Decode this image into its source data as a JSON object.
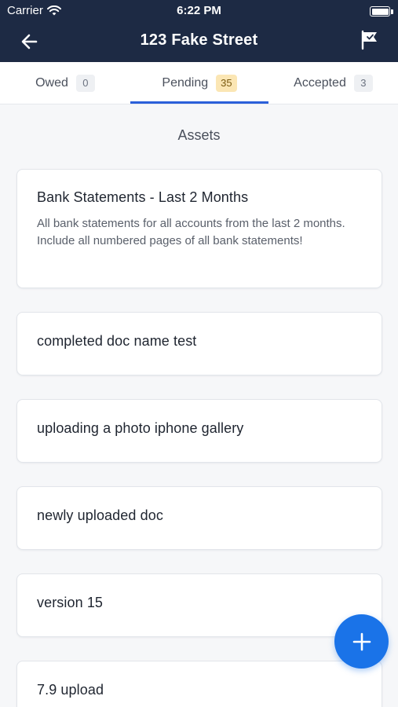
{
  "status_bar": {
    "carrier": "Carrier",
    "time": "6:22 PM",
    "wifi_icon": "wifi-icon",
    "battery_level": 1.0
  },
  "header": {
    "title": "123 Fake Street",
    "back_icon": "arrow-left-icon",
    "flag_icon": "flag-icon"
  },
  "tabs": [
    {
      "label": "Owed",
      "count": "0",
      "active": false
    },
    {
      "label": "Pending",
      "count": "35",
      "active": true
    },
    {
      "label": "Accepted",
      "count": "3",
      "active": false
    }
  ],
  "section": {
    "title": "Assets"
  },
  "documents": [
    {
      "title": "Bank Statements - Last 2 Months",
      "description": "All bank statements for all accounts from the last 2 months. Include all numbered pages of all bank statements!"
    },
    {
      "title": "completed doc name test"
    },
    {
      "title": "uploading a photo iphone gallery"
    },
    {
      "title": "newly uploaded doc"
    },
    {
      "title": "version 15"
    },
    {
      "title": "7.9 upload"
    }
  ],
  "fab": {
    "icon": "plus-icon"
  },
  "colors": {
    "nav_bg": "#1d2a44",
    "accent": "#2b5fd9",
    "fab": "#1a73e8",
    "pending_badge": "#fbe6b4"
  }
}
